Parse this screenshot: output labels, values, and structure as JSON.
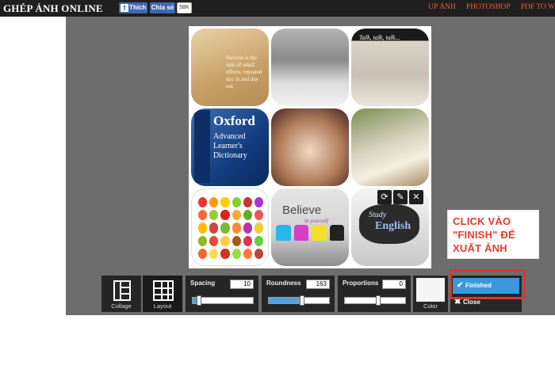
{
  "header": {
    "logo": "GHÉP ẢNH ONLINE",
    "fb_like": "Thích",
    "fb_share": "Chia sẻ",
    "fb_count": "58K",
    "nav": [
      "UP ẢNH",
      "PHOTOSHOP",
      "PDF TO W"
    ]
  },
  "collage": {
    "tiles": [
      {
        "name": "footprints-sand",
        "text": "Success is the sum of small efforts, repeated day in and day out."
      },
      {
        "name": "office-meeting",
        "text": ""
      },
      {
        "name": "talk-talk",
        "text": "Talk, talk, talk..."
      },
      {
        "name": "oxford-dictionary",
        "title": "Oxford",
        "sub": "Advanced Learner's Dictionary"
      },
      {
        "name": "writing-hand",
        "text": ""
      },
      {
        "name": "reading-book",
        "text": ""
      },
      {
        "name": "fruit-vocabulary",
        "text": ""
      },
      {
        "name": "believe-chairs",
        "title": "Believe",
        "sub": "in yourself"
      },
      {
        "name": "study-english",
        "title": "Study",
        "sub": "English"
      }
    ],
    "tile_tools": [
      "refresh-icon",
      "edit-icon",
      "close-icon"
    ]
  },
  "callout": {
    "lines": [
      "CLICK VÀO",
      "\"FINISH\" ĐỂ",
      "XUẤT ẢNH"
    ]
  },
  "toolbar": {
    "collage_label": "Collage",
    "layout_label": "Layout",
    "spacing": {
      "label": "Spacing",
      "value": "10",
      "fraction": 0.1
    },
    "roundness": {
      "label": "Roundness",
      "value": "163",
      "fraction": 0.55
    },
    "proportions": {
      "label": "Proportions",
      "value": "0",
      "fraction": 0.55
    },
    "color_label": "Color",
    "finished_label": "Finished",
    "close_label": "Close"
  },
  "colors": {
    "accent": "#3a98dd",
    "callout_text": "#e53b2c",
    "nav_link": "#f0603a"
  }
}
